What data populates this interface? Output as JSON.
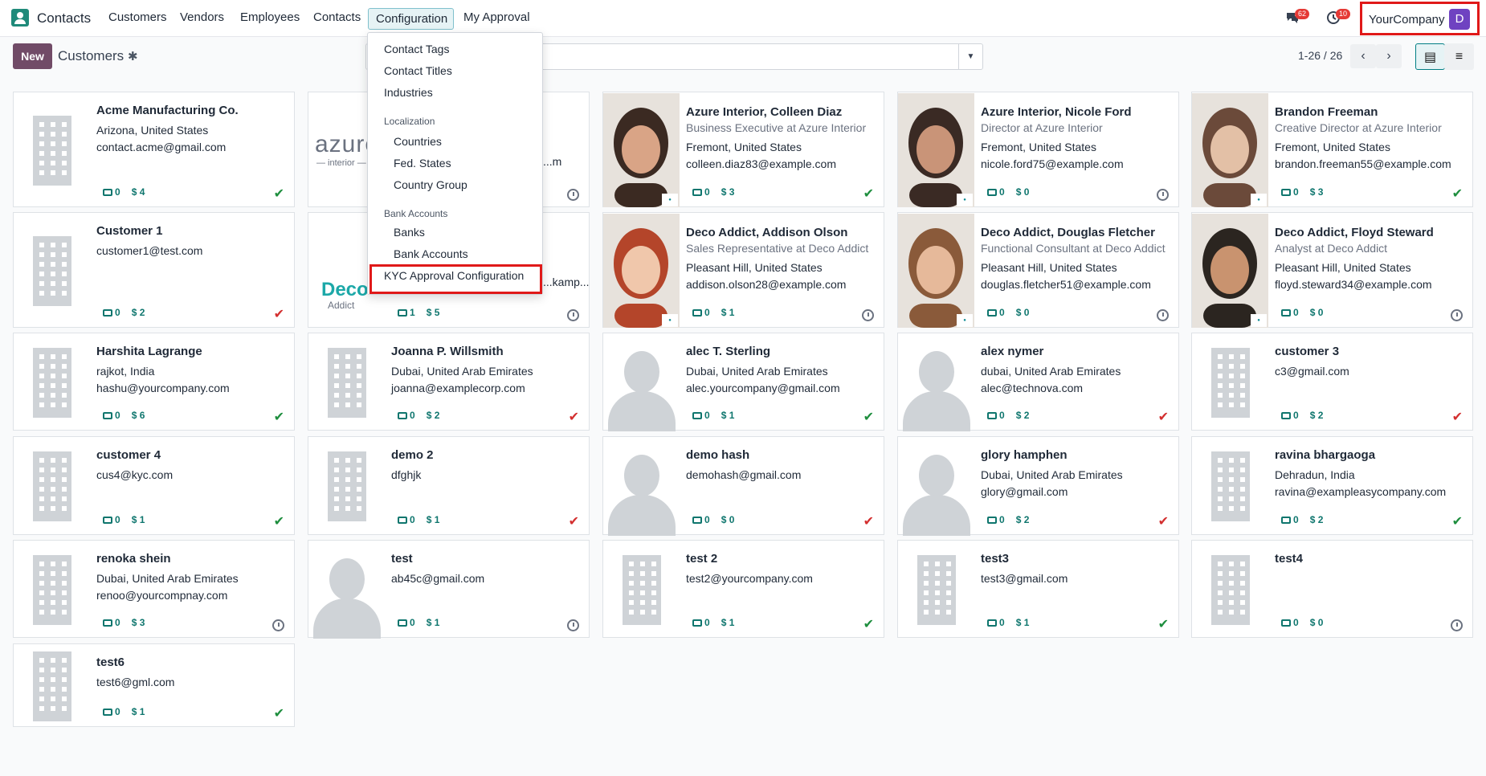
{
  "navbar": {
    "app_name": "Contacts",
    "menu": [
      "Customers",
      "Vendors",
      "Employees",
      "Contacts",
      "Configuration",
      "My Approval"
    ],
    "messages_badge": "62",
    "activities_badge": "10",
    "company": "YourCompany",
    "avatar_letter": "D"
  },
  "control": {
    "new_label": "New",
    "title": "Customers",
    "search_placeholder": "Search...",
    "pager": "1-26 / 26"
  },
  "dropdown": {
    "items_top": [
      "Contact Tags",
      "Contact Titles",
      "Industries"
    ],
    "localization_header": "Localization",
    "localization_items": [
      "Countries",
      "Fed. States",
      "Country Group"
    ],
    "bank_header": "Bank Accounts",
    "bank_items": [
      "Banks",
      "Bank Accounts"
    ],
    "kyc_item": "KYC Approval Configuration"
  },
  "cards": [
    {
      "name": "Acme Manufacturing Co.",
      "lines": [
        "Arizona, United States",
        "contact.acme@gmail.com"
      ],
      "c1": "0",
      "c2": "$ 4",
      "status": "ok"
    },
    {
      "name": "Azure Interior",
      "lines": [
        "",
        "...m"
      ],
      "c1": "",
      "c2": "",
      "status": "clock"
    },
    {
      "name": "Azure Interior, Colleen Diaz",
      "job": "Business Executive at Azure Interior",
      "lines": [
        "Fremont, United States",
        "colleen.diaz83@example.com"
      ],
      "c1": "0",
      "c2": "$ 3",
      "status": "ok"
    },
    {
      "name": "Azure Interior, Nicole Ford",
      "job": "Director at Azure Interior",
      "lines": [
        "Fremont, United States",
        "nicole.ford75@example.com"
      ],
      "c1": "0",
      "c2": "$ 0",
      "status": "clock"
    },
    {
      "name": "Brandon Freeman",
      "job": "Creative Director at Azure Interior",
      "lines": [
        "Fremont, United States",
        "brandon.freeman55@example.com"
      ],
      "c1": "0",
      "c2": "$ 3",
      "status": "ok"
    },
    {
      "name": "Customer 1",
      "lines": [
        "customer1@test.com",
        ""
      ],
      "c1": "0",
      "c2": "$ 2",
      "status": "bad"
    },
    {
      "name": "Deco Addict",
      "lines": [
        "",
        "...kamp..."
      ],
      "c1": "1",
      "c2": "$ 5",
      "status": "clock"
    },
    {
      "name": "Deco Addict, Addison Olson",
      "job": "Sales Representative at Deco Addict",
      "lines": [
        "Pleasant Hill, United States",
        "addison.olson28@example.com"
      ],
      "c1": "0",
      "c2": "$ 1",
      "status": "clock"
    },
    {
      "name": "Deco Addict, Douglas Fletcher",
      "job": "Functional Consultant at Deco Addict",
      "lines": [
        "Pleasant Hill, United States",
        "douglas.fletcher51@example.com"
      ],
      "c1": "0",
      "c2": "$ 0",
      "status": "clock"
    },
    {
      "name": "Deco Addict, Floyd Steward",
      "job": "Analyst at Deco Addict",
      "lines": [
        "Pleasant Hill, United States",
        "floyd.steward34@example.com"
      ],
      "c1": "0",
      "c2": "$ 0",
      "status": "clock"
    },
    {
      "name": "Harshita Lagrange",
      "lines": [
        "rajkot, India",
        "hashu@yourcompany.com"
      ],
      "c1": "0",
      "c2": "$ 6",
      "status": "ok"
    },
    {
      "name": "Joanna P. Willsmith",
      "lines": [
        "Dubai, United Arab Emirates",
        "joanna@examplecorp.com"
      ],
      "c1": "0",
      "c2": "$ 2",
      "status": "bad"
    },
    {
      "name": "alec T. Sterling",
      "lines": [
        "Dubai, United Arab Emirates",
        "alec.yourcompany@gmail.com"
      ],
      "c1": "0",
      "c2": "$ 1",
      "status": "ok"
    },
    {
      "name": "alex nymer",
      "lines": [
        "dubai, United Arab Emirates",
        "alec@technova.com"
      ],
      "c1": "0",
      "c2": "$ 2",
      "status": "bad"
    },
    {
      "name": "customer 3",
      "lines": [
        "c3@gmail.com",
        ""
      ],
      "c1": "0",
      "c2": "$ 2",
      "status": "bad"
    },
    {
      "name": "customer 4",
      "lines": [
        "cus4@kyc.com",
        ""
      ],
      "c1": "0",
      "c2": "$ 1",
      "status": "ok"
    },
    {
      "name": "demo 2",
      "lines": [
        "dfghjk",
        ""
      ],
      "c1": "0",
      "c2": "$ 1",
      "status": "bad"
    },
    {
      "name": "demo hash",
      "lines": [
        "demohash@gmail.com",
        ""
      ],
      "c1": "0",
      "c2": "$ 0",
      "status": "bad"
    },
    {
      "name": "glory hamphen",
      "lines": [
        "Dubai, United Arab Emirates",
        "glory@gmail.com"
      ],
      "c1": "0",
      "c2": "$ 2",
      "status": "bad"
    },
    {
      "name": "ravina bhargaoga",
      "lines": [
        "Dehradun, India",
        "ravina@exampleasycompany.com"
      ],
      "c1": "0",
      "c2": "$ 2",
      "status": "ok"
    },
    {
      "name": "renoka shein",
      "lines": [
        "Dubai, United Arab Emirates",
        "renoo@yourcompnay.com"
      ],
      "c1": "0",
      "c2": "$ 3",
      "status": "clock"
    },
    {
      "name": "test",
      "lines": [
        "ab45c@gmail.com",
        ""
      ],
      "c1": "0",
      "c2": "$ 1",
      "status": "clock"
    },
    {
      "name": "test 2",
      "lines": [
        "test2@yourcompany.com",
        ""
      ],
      "c1": "0",
      "c2": "$ 1",
      "status": "ok"
    },
    {
      "name": "test3",
      "lines": [
        "test3@gmail.com",
        ""
      ],
      "c1": "0",
      "c2": "$ 1",
      "status": "ok"
    },
    {
      "name": "test4",
      "lines": [
        "",
        ""
      ],
      "c1": "0",
      "c2": "$ 0",
      "status": "clock"
    },
    {
      "name": "test6",
      "lines": [
        "test6@gml.com",
        ""
      ],
      "c1": "0",
      "c2": "$ 1",
      "status": "ok"
    }
  ],
  "logos": {
    "azure": "azure",
    "azure_sub": "— interior —",
    "deco": "Deco",
    "deco_sub": "Addict"
  },
  "colors": {
    "brand": "#714b67",
    "accent": "#017e84",
    "highlight_box": "#e01919",
    "ok": "#1e8e3e",
    "bad": "#d32f2f"
  }
}
